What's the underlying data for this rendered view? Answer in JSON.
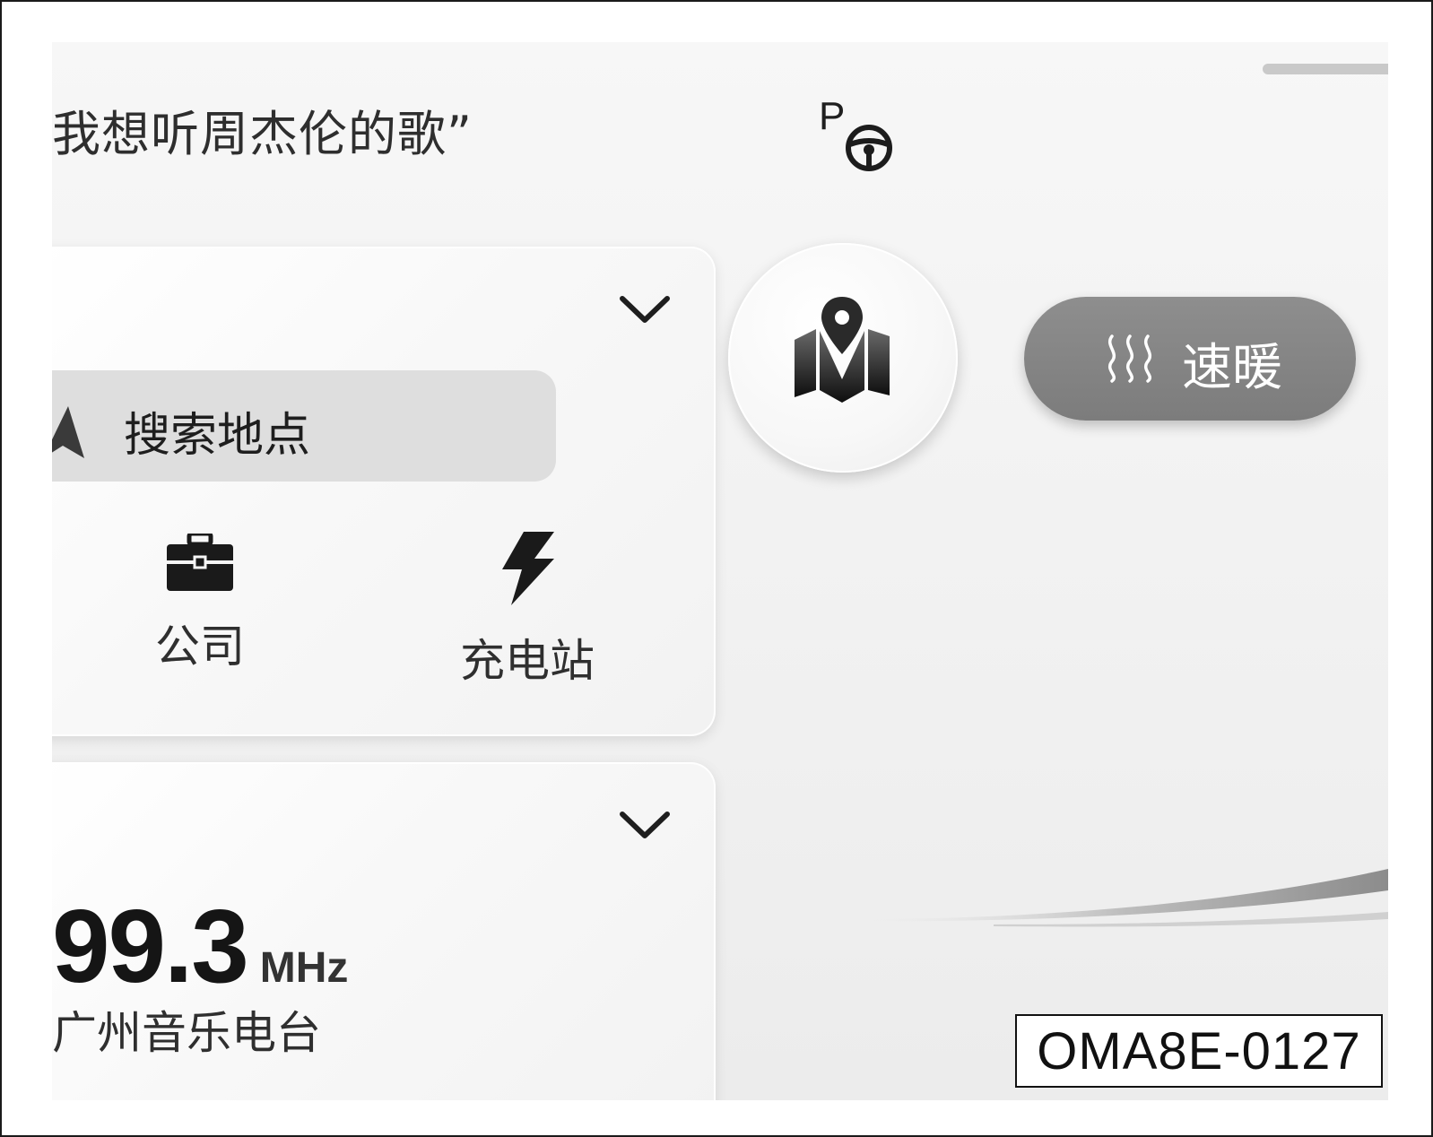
{
  "voice_hint": "我想听周杰伦的歌”",
  "gear": {
    "letter": "P",
    "icon": "steering-wheel-icon"
  },
  "navigation_card": {
    "expand_icon": "chevron-down-icon",
    "search_placeholder": "搜索地点",
    "shortcuts": [
      {
        "label": "公司",
        "icon": "briefcase-icon"
      },
      {
        "label": "充电站",
        "icon": "lightning-bolt-icon"
      }
    ]
  },
  "radio_card": {
    "expand_icon": "chevron-down-icon",
    "frequency": "99.3",
    "unit": "MHz",
    "station": "广州音乐电台"
  },
  "map_button": {
    "icon": "map-pin-icon"
  },
  "quick_heat": {
    "label": "速暖",
    "icon": "heat-waves-icon"
  },
  "figure_code": "OMA8E-0127",
  "colors": {
    "accent_pill": "#858585",
    "background": "#f1f1f1"
  }
}
